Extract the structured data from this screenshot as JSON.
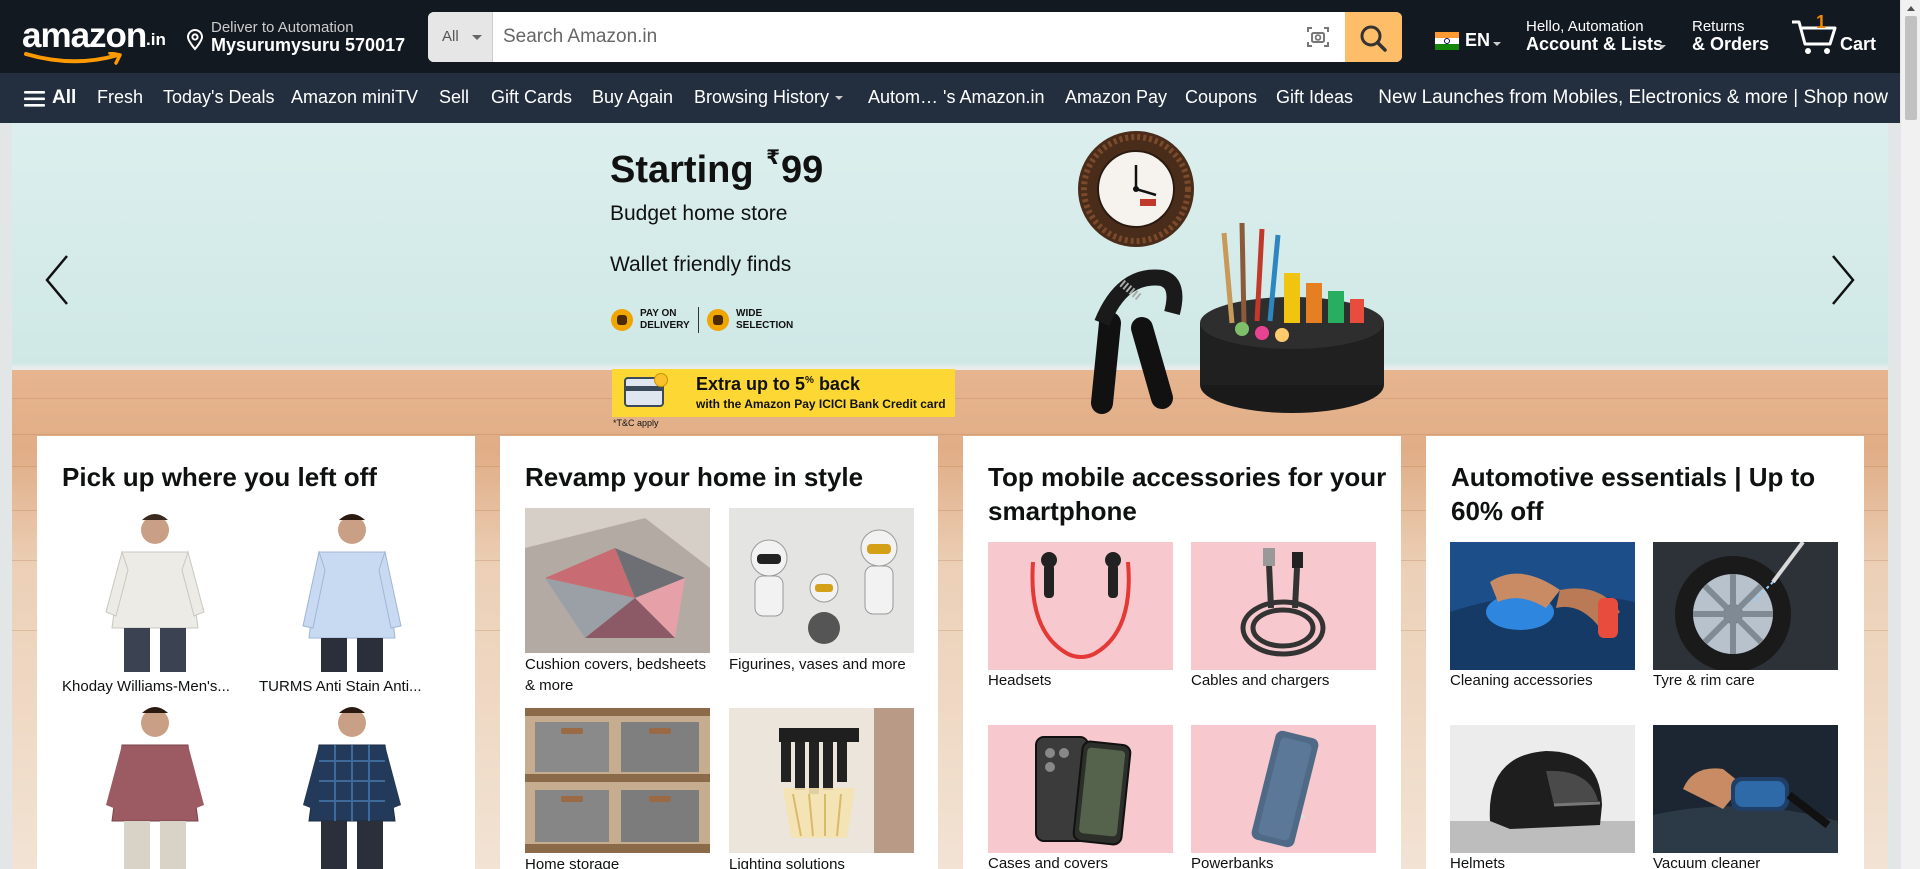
{
  "header": {
    "logo_text": "amazon",
    "logo_tld": ".in",
    "deliver_line1": "Deliver to Automation",
    "deliver_line2": "Mysurumysuru 570017",
    "search_category": "All",
    "search_placeholder": "Search Amazon.in",
    "language": "EN",
    "account_line1": "Hello, Automation",
    "account_line2": "Account & Lists",
    "orders_line1": "Returns",
    "orders_line2": "& Orders",
    "cart_count": "1",
    "cart_label": "Cart"
  },
  "nav": {
    "all_label": "All",
    "items": [
      "Fresh",
      "Today's Deals",
      "Amazon miniTV",
      "Sell",
      "Gift Cards",
      "Buy Again",
      "Browsing History",
      "Autom… 's Amazon.in",
      "Amazon Pay",
      "Coupons",
      "Gift Ideas"
    ],
    "promo": "New Launches from Mobiles, Electronics & more | Shop now"
  },
  "hero": {
    "title_prefix": "Starting ",
    "currency": "₹",
    "price": "99",
    "subtitle": "Budget home store",
    "tagline": "Wallet friendly finds",
    "badge1_l1": "PAY ON",
    "badge1_l2": "DELIVERY",
    "badge2_l1": "WIDE",
    "badge2_l2": "SELECTION",
    "offer_title": "Extra up to 5",
    "offer_pct": "%",
    "offer_back": " back",
    "offer_sub": "with the Amazon Pay ICICI Bank Credit card",
    "tc": "*T&C apply"
  },
  "cards": [
    {
      "title": "Pick up where you left off",
      "tiles": [
        "Khoday Williams-Men's...",
        "TURMS Anti Stain Anti...",
        "",
        ""
      ]
    },
    {
      "title": "Revamp your home in style",
      "tiles": [
        "Cushion covers, bedsheets & more",
        "Figurines, vases and more",
        "Home storage",
        "Lighting solutions"
      ]
    },
    {
      "title": "Top mobile accessories for your smartphone",
      "tiles": [
        "Headsets",
        "Cables and chargers",
        "Cases and covers",
        "Powerbanks"
      ]
    },
    {
      "title": "Automotive essentials | Up to 60% off",
      "tiles": [
        "Cleaning accessories",
        "Tyre & rim care",
        "Helmets",
        "Vacuum cleaner"
      ]
    }
  ],
  "colors": {
    "header_bg": "#131921",
    "nav_bg": "#232f3e",
    "search_button": "#febd69",
    "cart_count": "#f08804",
    "offer_banner": "#fdd835"
  },
  "icons": [
    "location-pin-icon",
    "camera-search-icon",
    "search-icon",
    "india-flag-icon",
    "cart-icon",
    "hamburger-icon",
    "chevron-left-icon",
    "chevron-right-icon"
  ]
}
